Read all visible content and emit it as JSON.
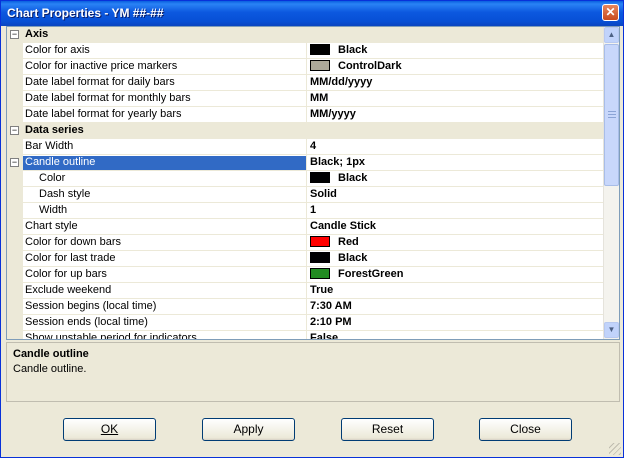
{
  "window": {
    "title": "Chart Properties - YM ##-##",
    "close_glyph": "✕"
  },
  "grid": {
    "rows": [
      {
        "type": "category",
        "expanded": true,
        "name": "Axis"
      },
      {
        "type": "prop",
        "name": "Color for axis",
        "value": "Black",
        "swatch": "#000000"
      },
      {
        "type": "prop",
        "name": "Color for inactive price markers",
        "value": "ControlDark",
        "swatch": "#aca899"
      },
      {
        "type": "prop",
        "name": "Date label format for daily bars",
        "value": "MM/dd/yyyy"
      },
      {
        "type": "prop",
        "name": "Date label format for monthly bars",
        "value": "MM"
      },
      {
        "type": "prop",
        "name": "Date label format for yearly bars",
        "value": "MM/yyyy"
      },
      {
        "type": "category",
        "expanded": true,
        "name": "Data series"
      },
      {
        "type": "prop",
        "name": "Bar Width",
        "value": "4"
      },
      {
        "type": "prop",
        "name": "Candle outline",
        "value": "Black; 1px",
        "expandable": true,
        "selected": true
      },
      {
        "type": "prop",
        "name": "Color",
        "value": "Black",
        "swatch": "#000000",
        "indent": true
      },
      {
        "type": "prop",
        "name": "Dash style",
        "value": "Solid",
        "indent": true
      },
      {
        "type": "prop",
        "name": "Width",
        "value": "1",
        "indent": true
      },
      {
        "type": "prop",
        "name": "Chart style",
        "value": "Candle Stick"
      },
      {
        "type": "prop",
        "name": "Color for down bars",
        "value": "Red",
        "swatch": "#ff0000"
      },
      {
        "type": "prop",
        "name": "Color for last trade",
        "value": "Black",
        "swatch": "#000000"
      },
      {
        "type": "prop",
        "name": "Color for up bars",
        "value": "ForestGreen",
        "swatch": "#228b22"
      },
      {
        "type": "prop",
        "name": "Exclude weekend",
        "value": "True"
      },
      {
        "type": "prop",
        "name": "Session begins (local time)",
        "value": "7:30 AM"
      },
      {
        "type": "prop",
        "name": "Session ends (local time)",
        "value": "2:10 PM"
      },
      {
        "type": "prop",
        "name": "Show unstable period for indicators",
        "value": "False"
      }
    ]
  },
  "description": {
    "title": "Candle outline",
    "text": "Candle outline."
  },
  "buttons": {
    "ok": "OK",
    "apply": "Apply",
    "reset": "Reset",
    "close": "Close"
  },
  "colors": {
    "selection": "#316ac5",
    "titlebar": "#0a5fe0",
    "dialog_bg": "#ece9d8"
  }
}
